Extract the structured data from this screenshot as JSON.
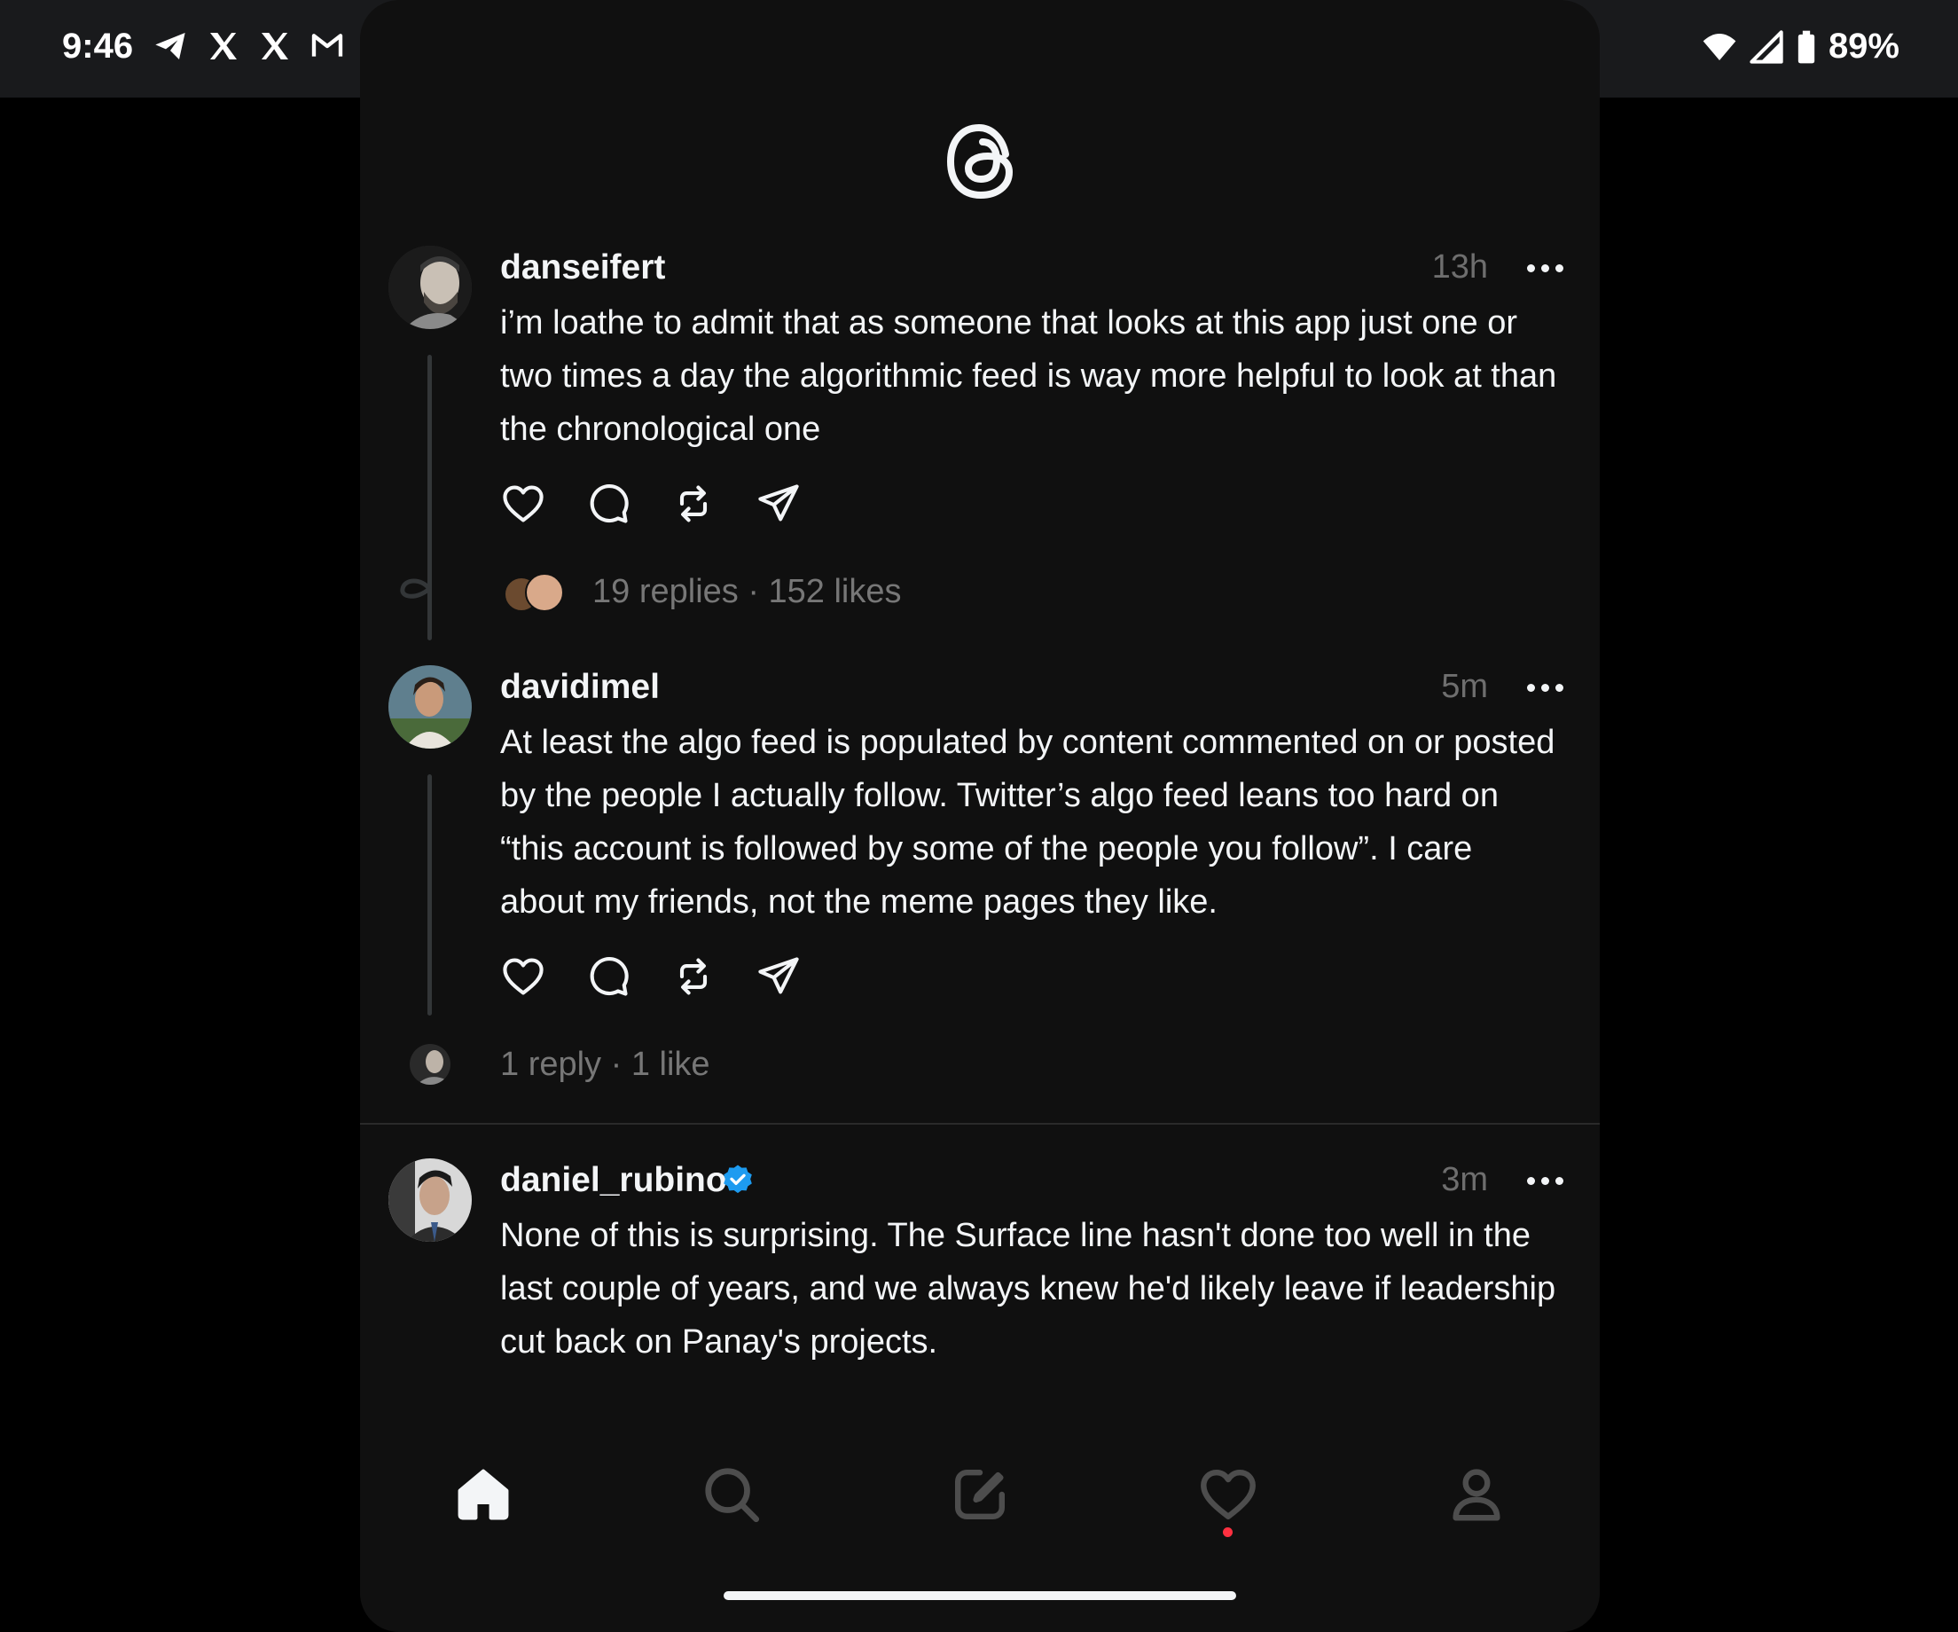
{
  "status_bar": {
    "time": "9:46",
    "battery": "89%",
    "icons_left": [
      "telegram-icon",
      "x-icon",
      "x-icon",
      "gmail-icon",
      "dot-icon"
    ],
    "icons_right": [
      "wifi-icon",
      "signal-icon",
      "battery-icon"
    ]
  },
  "app": {
    "name": "Threads",
    "logo": "threads-logo-icon"
  },
  "posts": [
    {
      "username": "danseifert",
      "time": "13h",
      "text": "i’m loathe to admit that as someone that looks at this app just one or two times a day the algorithmic feed is way more helpful to look at than the chronological one",
      "stats": "19 replies · 152 likes"
    },
    {
      "username": "davidimel",
      "time": "5m",
      "text": "At least the algo feed is populated by content commented on or posted by the people I actually follow. Twitter’s algo feed leans too hard on “this account is followed by some of the people you follow”. I care about my friends, not the meme pages they like.",
      "stats": "1 reply · 1 like"
    },
    {
      "username": "daniel_rubino",
      "verified": true,
      "time": "3m",
      "text": "None of this is surprising. The Surface line hasn't done too well in the last couple of years, and we always knew he'd likely leave if leadership cut back on Panay's projects."
    }
  ],
  "nav": {
    "items": [
      "home-icon",
      "search-icon",
      "compose-icon",
      "activity-heart-icon",
      "profile-icon"
    ],
    "active": "home-icon",
    "badge_color": "#ff3040"
  },
  "colors": {
    "background": "#101010",
    "text": "#f3f5f7",
    "muted": "#777777",
    "verified": "#1d9bf0"
  }
}
